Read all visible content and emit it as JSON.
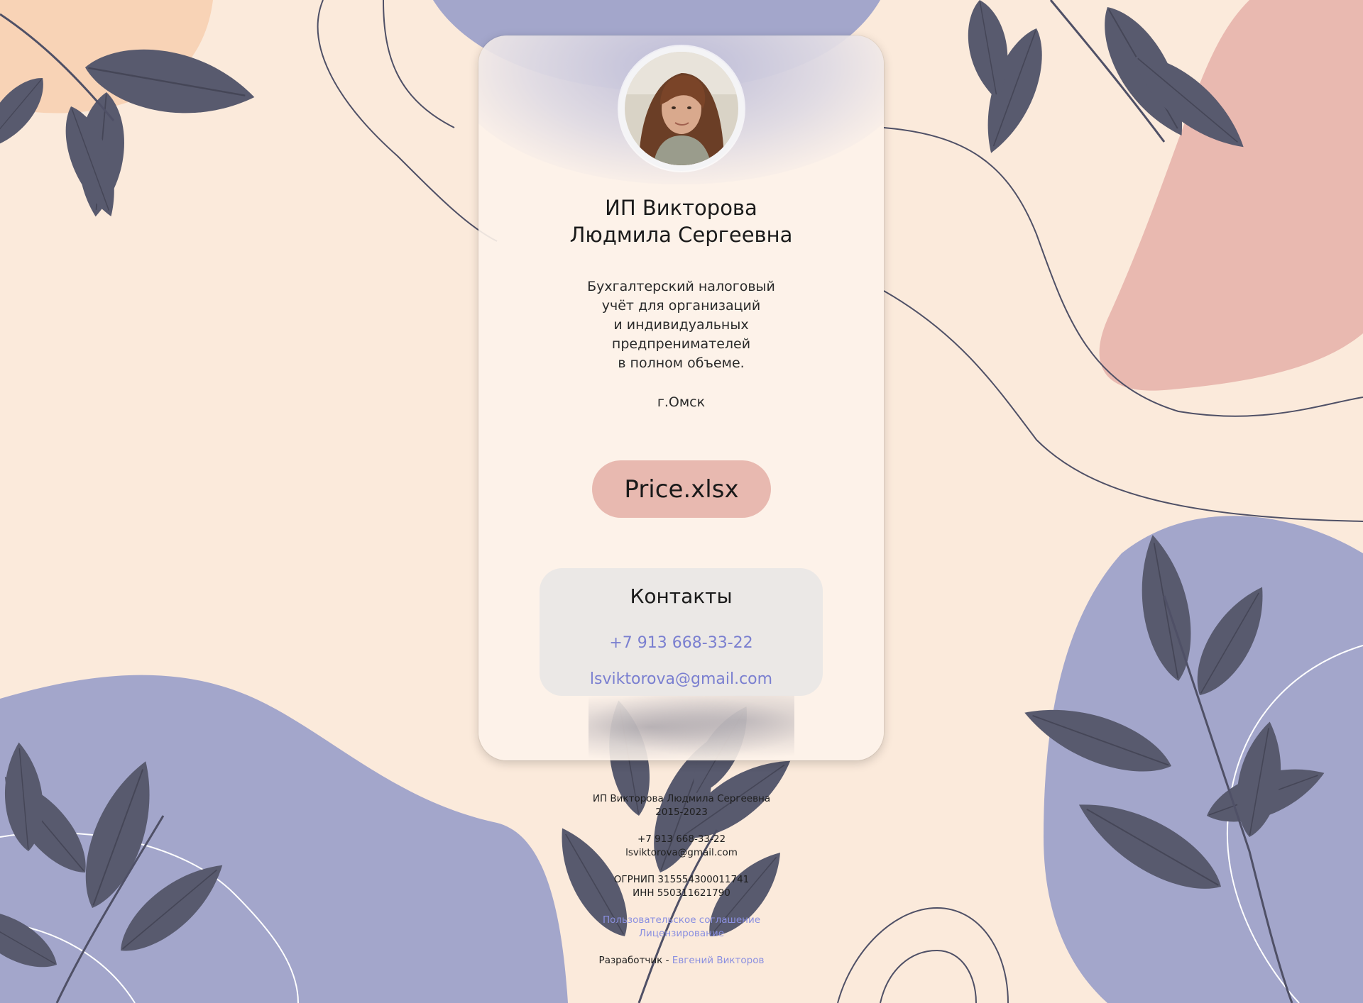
{
  "card": {
    "name_line1": "ИП Викторова",
    "name_line2": "Людмила Сергеевна",
    "description": [
      "Бухгалтерский налоговый",
      "учёт для организаций",
      "и индивидуальных",
      "предпренимателей",
      "в полном объеме."
    ],
    "city": "г.Омск",
    "price_button": "Price.xlsx"
  },
  "contacts": {
    "title": "Контакты",
    "phone": "+7 913 668-33-22",
    "email": "lsviktorova@gmail.com"
  },
  "footer": {
    "owner": "ИП Викторова Людмила Сергеевна",
    "years": "2015-2023",
    "phone": "+7 913 668-33-22",
    "email": "lsviktorova@gmail.com",
    "ogrnip": "ОГРНИП 315554300011741",
    "inn": "ИНН 550311621790",
    "agreement_link": "Пользовательское соглашение",
    "license_link": "Лицензирование",
    "developer_prefix": "Разработчик - ",
    "developer_link": "Евгений Викторов"
  },
  "colors": {
    "background": "#fbeadb",
    "peach": "#f8d3b6",
    "lavender": "#a3a6cb",
    "pink": "#e9b9b0",
    "leaf": "#585a6e",
    "link": "#7a7fd0",
    "price_button": "#e8b9b0"
  }
}
